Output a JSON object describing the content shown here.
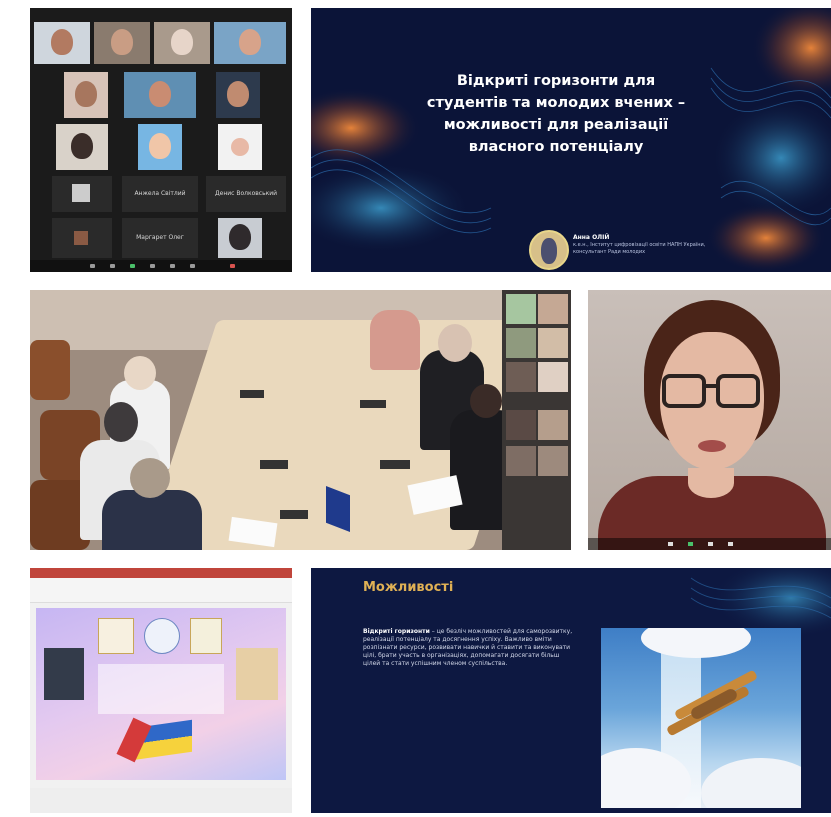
{
  "call_grid": {
    "participant_names": [
      "Анжела Світлий",
      "Денис Волковський",
      "Маргарет Олег"
    ]
  },
  "title_slide": {
    "title": "Відкриті горизонти для студентів та молодих вчених – можливості для реалізації власного потенціалу",
    "speaker_name": "Анна ОЛІЙ",
    "speaker_info": "к.е.н., Інститут цифровізації освіти НАПН України, консультант Ради молодих"
  },
  "opportunities_slide": {
    "title": "Можливості",
    "body_lead": "Відкриті горизонти",
    "body_text": "– це безліч можливостей для саморозвитку, реалізації потенціалу та досягнення успіху. Важливо вміти розпізнати ресурси, розвивати навички й ставити та виконувати цілі, брати участь в організаціях, допомагати досягати більш цілей та стати успішним членом суспільства."
  },
  "colors": {
    "slide_navy": "#0b1438",
    "accent_gold": "#e0b155",
    "call_dark": "#1b1b1b"
  }
}
